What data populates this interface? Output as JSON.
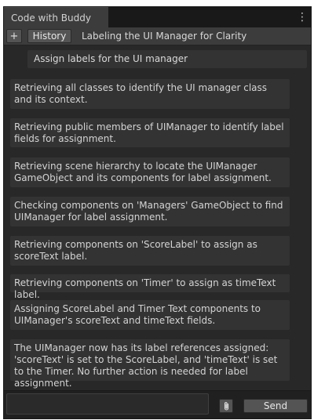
{
  "window": {
    "tab_title": "Code with Buddy",
    "menu_icon": "kebab-menu-icon"
  },
  "toolbar": {
    "new_label": "+",
    "history_label": "History",
    "conversation_title": "Labeling the UI Manager for Clarity"
  },
  "conversation": {
    "user_message": "Assign labels for the UI manager",
    "assistant_messages": [
      "Retrieving all classes to identify the UI manager class and its context.",
      "Retrieving public members of UIManager to identify label fields for assignment.",
      "Retrieving scene hierarchy to locate the UIManager GameObject and its components for label assignment.",
      "Checking components on 'Managers' GameObject to find UIManager for label assignment.",
      "Retrieving components on 'ScoreLabel' to assign as scoreText label.",
      "Retrieving components on 'Timer' to assign as timeText label.",
      "Assigning ScoreLabel and Timer Text components to UIManager's scoreText and timeText fields.",
      "The UIManager now has its label references assigned: 'scoreText' is set to the ScoreLabel, and 'timeText' is set to the Timer. No further action is needed for label assignment."
    ]
  },
  "composer": {
    "input_value": "",
    "attach_icon": "paperclip-icon",
    "send_label": "Send"
  },
  "colors": {
    "panel_bg": "#282828",
    "message_bg": "#333333",
    "toolbar_bg": "#3c3c3c",
    "button_bg": "#545454",
    "text": "#d4d4d4"
  }
}
